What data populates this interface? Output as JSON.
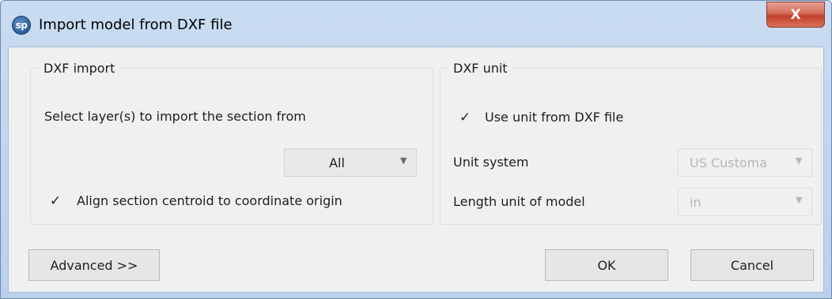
{
  "window": {
    "title": "Import model from DXF file",
    "app_icon_text": "sp",
    "close_label": "X"
  },
  "dxf_import": {
    "legend": "DXF import",
    "select_layers_label": "Select layer(s) to import the section from",
    "layer_select_value": "All",
    "align_checkbox_label": "Align section centroid to coordinate origin",
    "align_checked": true,
    "checkmark": "✓"
  },
  "dxf_unit": {
    "legend": "DXF unit",
    "use_unit_label": "Use unit from DXF file",
    "use_unit_checked": true,
    "checkmark": "✓",
    "unit_system_label": "Unit system",
    "unit_system_value": "US Customa",
    "length_unit_label": "Length unit of model",
    "length_unit_value": "in"
  },
  "buttons": {
    "advanced": "Advanced >>",
    "ok": "OK",
    "cancel": "Cancel"
  },
  "dropdown_arrow": "▼",
  "colors": {
    "title_bar": "#c9dcf1",
    "close_button": "#c9452f",
    "client_bg": "#f0f0f0"
  }
}
